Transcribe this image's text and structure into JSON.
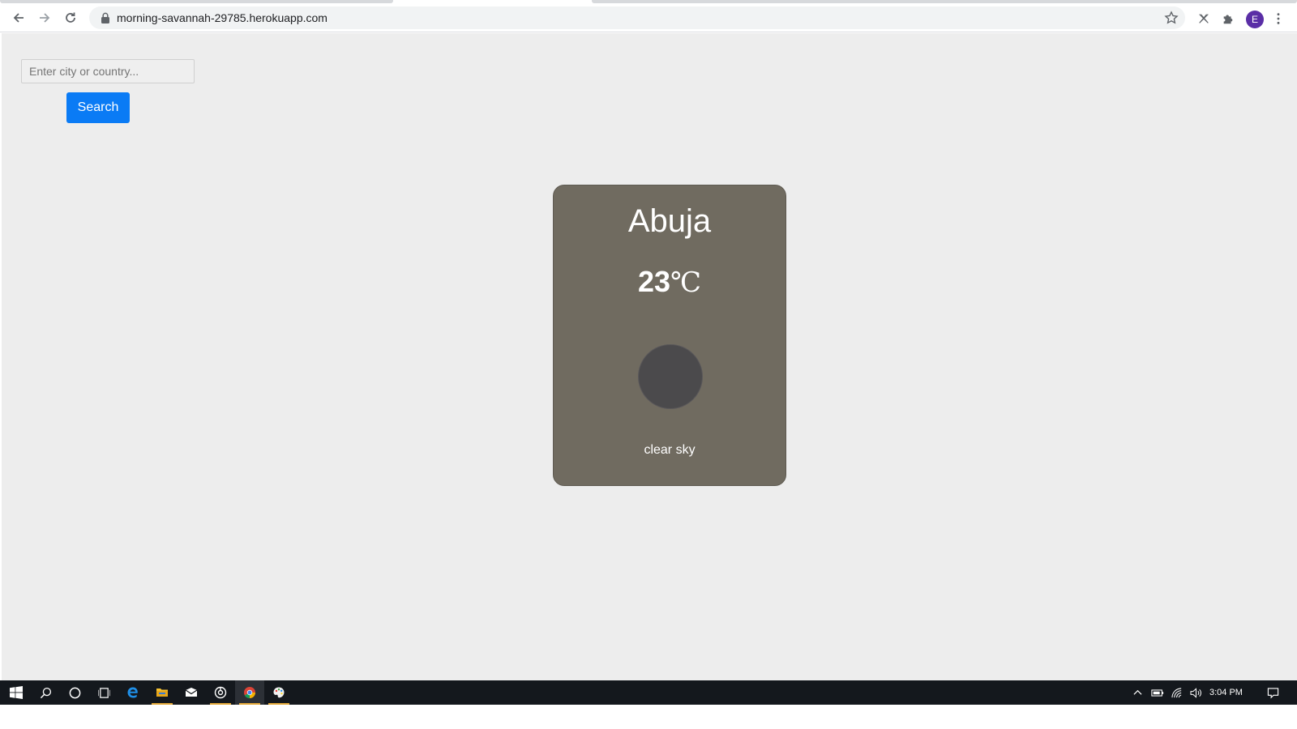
{
  "browser": {
    "url": "morning-savannah-29785.herokuapp.com",
    "profile_initial": "E"
  },
  "page": {
    "search": {
      "placeholder": "Enter city or country...",
      "value": "",
      "button_label": "Search"
    },
    "weather": {
      "city": "Abuja",
      "temperature": "23",
      "unit": "℃",
      "description": "clear sky",
      "icon": "weather-icon-placeholder"
    }
  },
  "taskbar": {
    "clock": "3:04 PM",
    "items": [
      "start",
      "search",
      "cortana",
      "task-view",
      "edge",
      "file-explorer",
      "mail",
      "media-app",
      "chrome",
      "paint"
    ]
  },
  "colors": {
    "page_background": "#ededed",
    "card_background": "#706b60",
    "button_primary": "#0a7bf5",
    "taskbar": "#14181d"
  }
}
